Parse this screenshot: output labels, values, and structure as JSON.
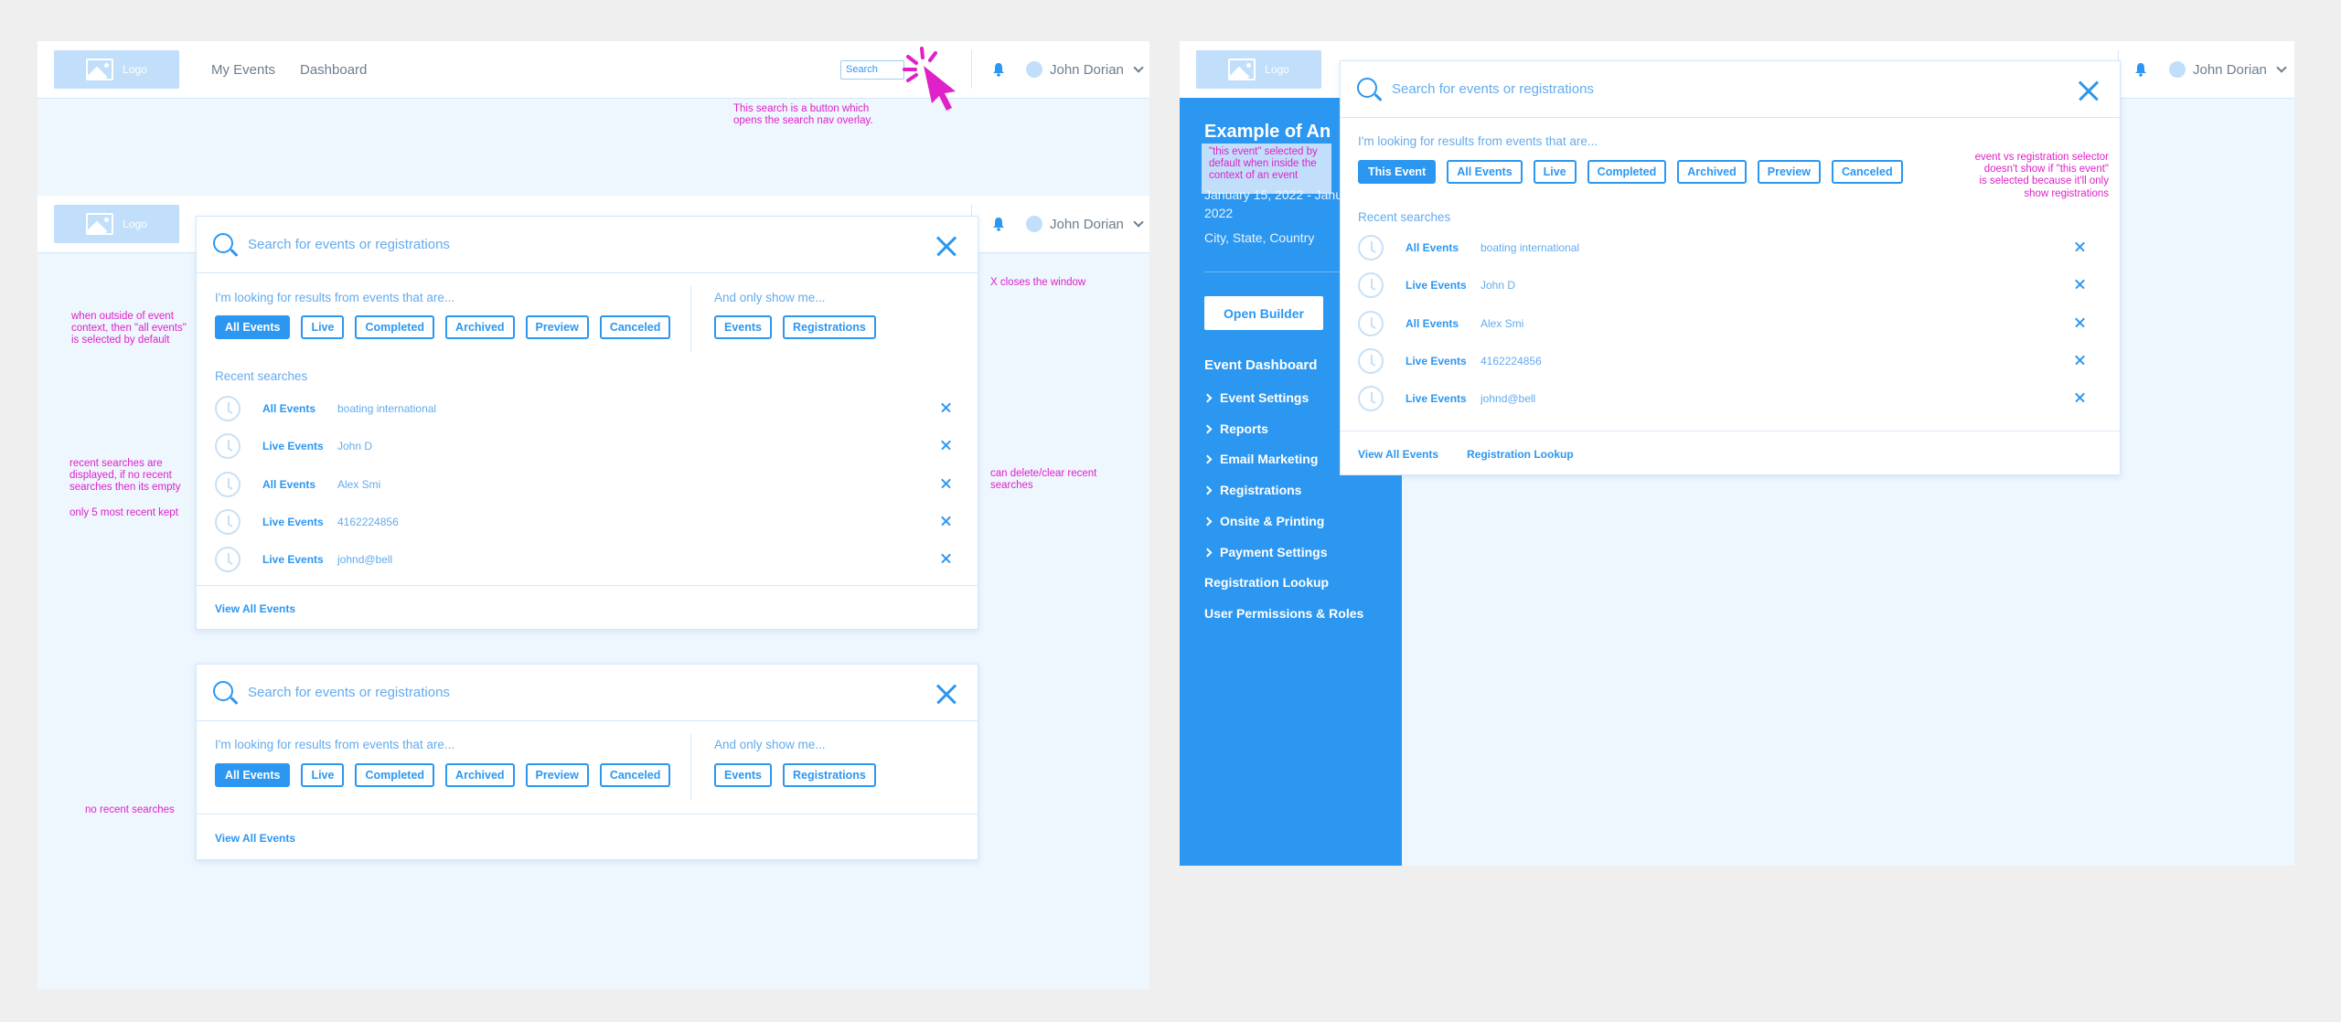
{
  "header": {
    "logo_label": "Logo",
    "nav": [
      "My Events",
      "Dashboard"
    ],
    "search_label": "Search",
    "user_name": "John Dorian"
  },
  "search_panel": {
    "placeholder": "Search for events or registrations",
    "filter_label": "I'm looking for results from events that are...",
    "filters": [
      "All Events",
      "Live",
      "Completed",
      "Archived",
      "Preview",
      "Canceled"
    ],
    "show_label": "And only show me...",
    "show_options": [
      "Events",
      "Registrations"
    ],
    "recent_label": "Recent searches",
    "recent": [
      {
        "type": "All Events",
        "term": "boating international"
      },
      {
        "type": "Live Events",
        "term": "John D"
      },
      {
        "type": "All Events",
        "term": "Alex Smi"
      },
      {
        "type": "Live Events",
        "term": "4162224856"
      },
      {
        "type": "Live Events",
        "term": "johnd@bell"
      }
    ],
    "view_all": "View All Events"
  },
  "event_panel": {
    "placeholder": "Search for events or registrations",
    "filter_label": "I'm looking for results from events that are...",
    "filters": [
      "This Event",
      "All Events",
      "Live",
      "Completed",
      "Archived",
      "Preview",
      "Canceled"
    ],
    "recent_label": "Recent searches",
    "recent": [
      {
        "type": "All Events",
        "term": "boating international"
      },
      {
        "type": "Live Events",
        "term": "John D"
      },
      {
        "type": "All Events",
        "term": "Alex Smi"
      },
      {
        "type": "Live Events",
        "term": "4162224856"
      },
      {
        "type": "Live Events",
        "term": "johnd@bell"
      }
    ],
    "view_all": "View All Events",
    "registration_lookup": "Registration Lookup"
  },
  "sidebar": {
    "title": "Example of An",
    "date_fragment": "January 15, 2022 - Janu",
    "year": "2022",
    "location": "City, State, Country",
    "open_builder": "Open Builder",
    "dashboard": "Event Dashboard",
    "items": [
      "Event Settings",
      "Reports",
      "Email Marketing",
      "Registrations",
      "Onsite & Printing",
      "Payment Settings"
    ],
    "registration_lookup": "Registration Lookup",
    "permissions": "User Permissions & Roles"
  },
  "notes": {
    "search_button": "This search is a button which\nopens the search nav overlay.",
    "x_closes": "X closes the window",
    "outside_context": "when outside of event\ncontext, then \"all events\"\nis selected by default",
    "recent_displayed": "recent searches are\ndisplayed, if no recent\nsearches then its empty",
    "five_recent": "only 5 most recent kept",
    "can_delete": "can delete/clear recent\nsearches",
    "no_recent": "no recent searches",
    "this_event": "\"this event\" selected by\ndefault when inside the\ncontext of an event",
    "event_vs_reg": "event vs registration selector\ndoesn't show if  \"this event\"\nis selected because it'll only\nshow registrations"
  },
  "colors": {
    "accent": "#2c97f0",
    "annotation": "#e020c8",
    "canvas": "#eef6fe"
  }
}
